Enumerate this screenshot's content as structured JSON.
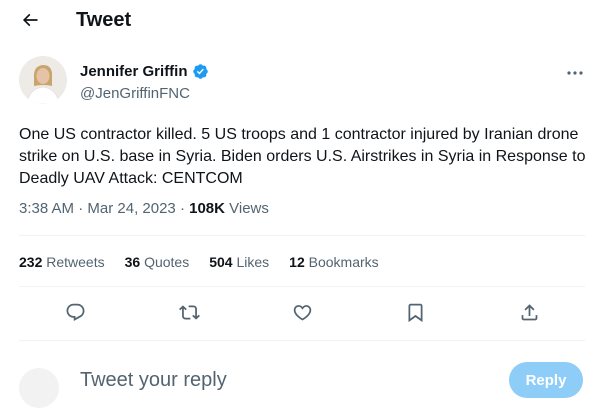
{
  "header": {
    "title": "Tweet",
    "back_icon": "arrow-left-icon"
  },
  "tweet": {
    "author_name": "Jennifer Griffin",
    "author_handle": "@JenGriffinFNC",
    "verified": true,
    "text": "One US contractor killed. 5 US troops and 1 contractor injured by Iranian drone strike on U.S. base in Syria. Biden orders U.S. Airstrikes in Syria in Response to Deadly UAV Attack: CENTCOM",
    "time": "3:38 AM",
    "separator": " · ",
    "date": "Mar 24, 2023",
    "views_count": "108K",
    "views_label": " Views"
  },
  "stats": [
    {
      "num": "232",
      "label": " Retweets"
    },
    {
      "num": "36",
      "label": " Quotes"
    },
    {
      "num": "504",
      "label": " Likes"
    },
    {
      "num": "12",
      "label": " Bookmarks"
    }
  ],
  "actions": [
    "reply-icon",
    "retweet-icon",
    "like-icon",
    "bookmark-icon",
    "share-icon"
  ],
  "reply": {
    "placeholder": "Tweet your reply",
    "button_label": "Reply"
  },
  "colors": {
    "text": "#0f1419",
    "secondary": "#536471",
    "accent": "#1d9bf0",
    "reply_button": "#8ecdf8",
    "divider": "#eff3f4"
  }
}
